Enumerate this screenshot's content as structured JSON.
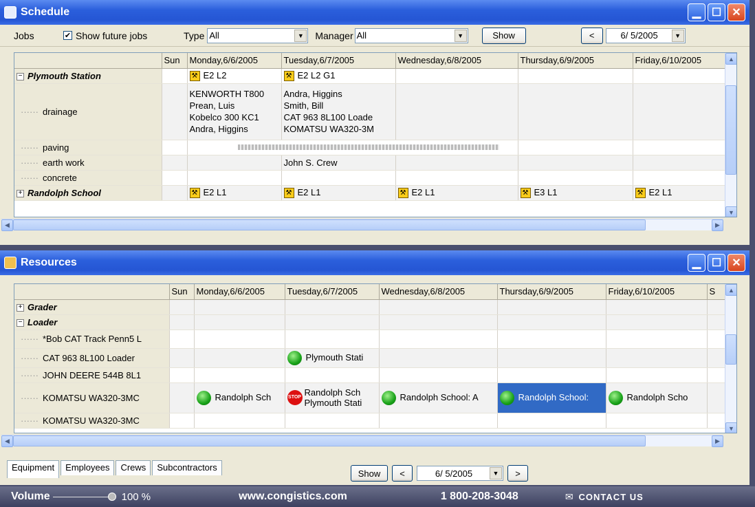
{
  "schedule": {
    "title": "Schedule",
    "jobs_label": "Jobs",
    "show_future_label": "Show future jobs",
    "type_label": "Type",
    "type_value": "All",
    "manager_label": "Manager",
    "manager_value": "All",
    "show_button": "Show",
    "prev_button": "<",
    "date_value": "6/ 5/2005",
    "columns": [
      "Sun",
      "Monday,6/6/2005",
      "Tuesday,6/7/2005",
      "Wednesday,6/8/2005",
      "Thursday,6/9/2005",
      "Friday,6/10/2005"
    ],
    "jobs": {
      "plymouth": {
        "name": "Plymouth Station",
        "mon": "E2 L2",
        "tue": "E2 L2 G1",
        "drainage": "drainage",
        "drainage_mon": [
          "KENWORTH T800",
          "Prean, Luis",
          "Kobelco 300 KC1",
          "Andra, Higgins"
        ],
        "drainage_tue": [
          "Andra, Higgins",
          "Smith, Bill",
          "CAT 963 8L100 Loade",
          "KOMATSU WA320-3M"
        ],
        "paving": "paving",
        "earth_work": "earth work",
        "earth_work_tue": "John S. Crew",
        "concrete": "concrete"
      },
      "randolph": {
        "name": "Randolph School",
        "mon": "E2 L1",
        "tue": "E2 L1",
        "wed": "E2 L1",
        "thu": "E3 L1",
        "fri": "E2 L1"
      }
    }
  },
  "resources": {
    "title": "Resources",
    "columns": [
      "Sun",
      "Monday,6/6/2005",
      "Tuesday,6/7/2005",
      "Wednesday,6/8/2005",
      "Thursday,6/9/2005",
      "Friday,6/10/2005",
      "S"
    ],
    "grader": "Grader",
    "loader": "Loader",
    "items": {
      "bobcat": "*Bob CAT Track Penn5 L",
      "cat963": "CAT 963 8L100 Loader",
      "cat963_tue": "Plymouth Stati",
      "johndeere": "JOHN DEERE 544B 8L1",
      "komatsu1": "KOMATSU WA320-3MC",
      "komatsu1_mon": "Randolph Sch",
      "komatsu1_tue_a": "Randolph Sch",
      "komatsu1_tue_b": "Plymouth Stati",
      "komatsu1_wed": "Randolph School: A",
      "komatsu1_thu": "Randolph School:",
      "komatsu1_fri": "Randolph Scho",
      "komatsu2": "KOMATSU WA320-3MC"
    },
    "stop_text": "STOP",
    "tabs": [
      "Equipment",
      "Employees",
      "Crews",
      "Subcontractors"
    ],
    "show_button": "Show",
    "prev_button": "<",
    "next_button": ">",
    "date_value": "6/ 5/2005"
  },
  "footer": {
    "volume_label": "Volume",
    "volume_value": "100 %",
    "website": "www.congistics.com",
    "phone": "1 800-208-3048",
    "contact": "CONTACT US"
  }
}
